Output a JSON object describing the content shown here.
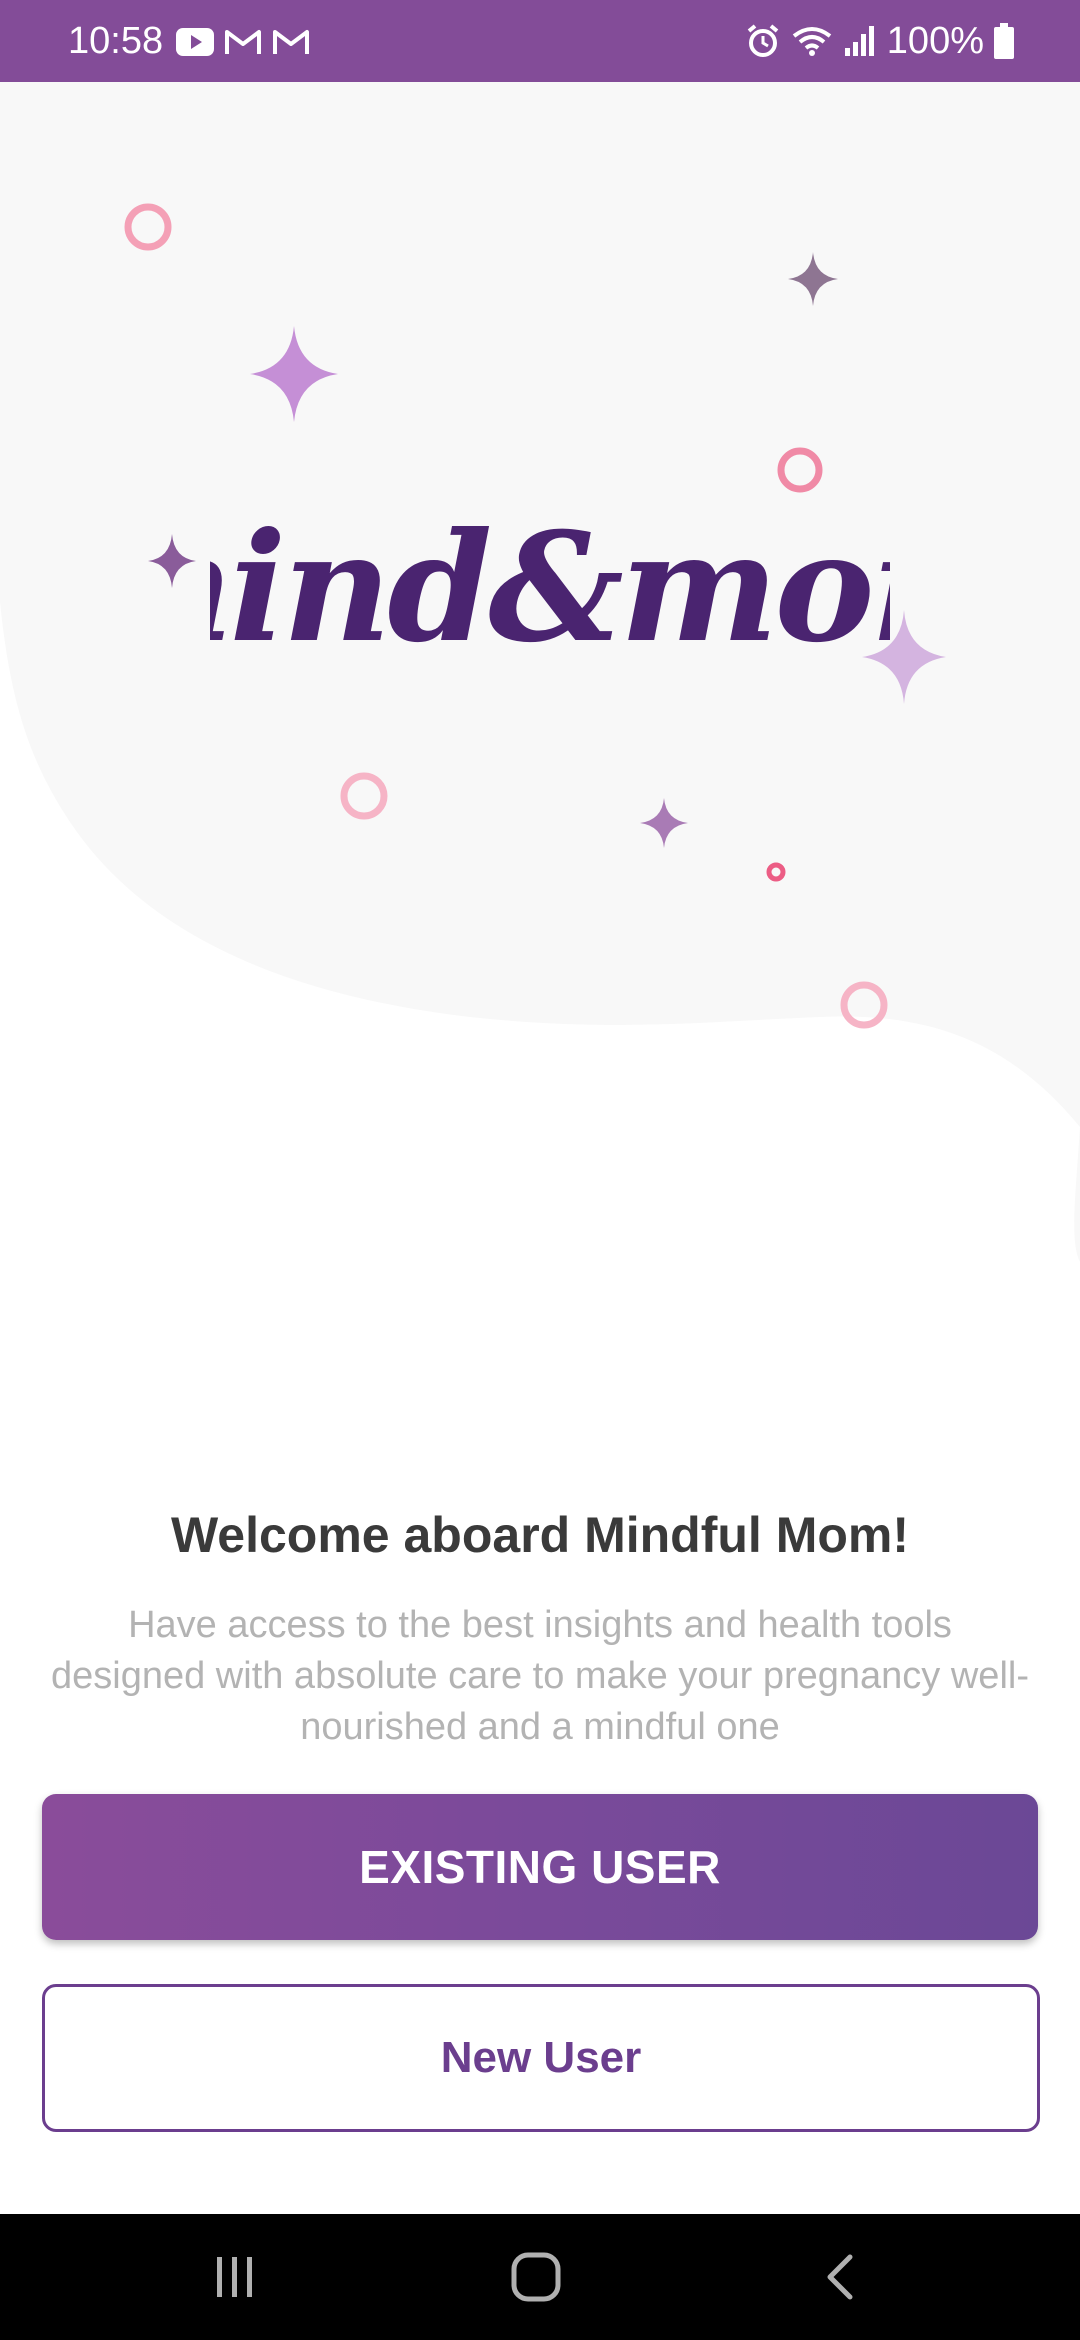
{
  "status_bar": {
    "time": "10:58",
    "battery": "100%",
    "icons": [
      "youtube-icon",
      "gmail-icon",
      "gmail-icon",
      "alarm-icon",
      "wifi-icon",
      "signal-icon",
      "battery-icon"
    ]
  },
  "logo": {
    "text": "mind&mom"
  },
  "welcome": {
    "title": "Welcome aboard Mindful Mom!",
    "description": "Have access to the best insights and health tools designed with absolute care to make your pregnancy well-nourished and a mindful one"
  },
  "buttons": {
    "existing_user": "EXISTING USER",
    "new_user": "New User"
  },
  "navigation": {
    "items": [
      "recents-button",
      "home-button",
      "back-button"
    ]
  },
  "colors": {
    "primary": "#834c98",
    "logo": "#4a2470",
    "accent_pink": "#f08aa6",
    "sparkle_light": "#c58fd6",
    "sparkle_dark": "#8a5c9a"
  }
}
